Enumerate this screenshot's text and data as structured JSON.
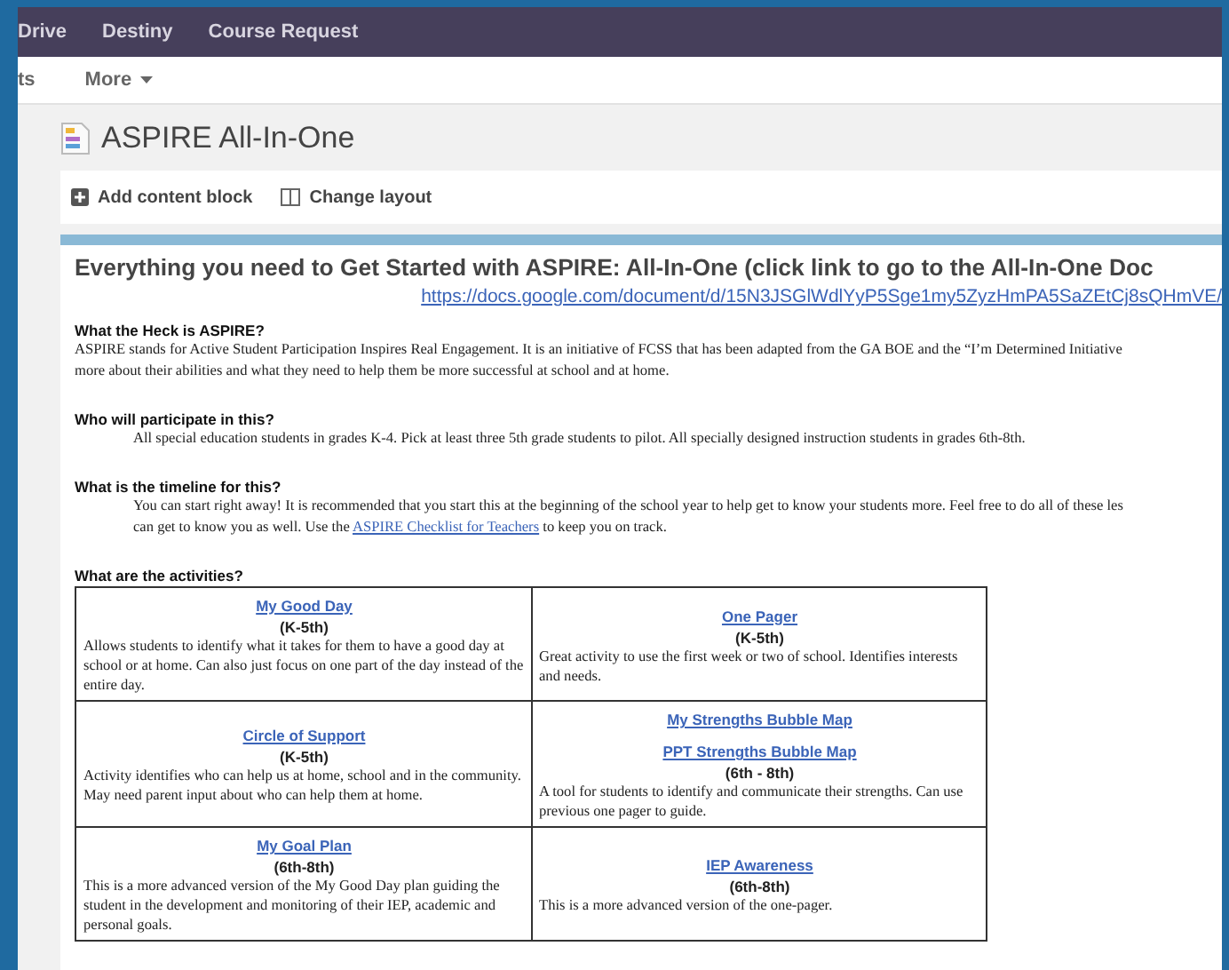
{
  "top_nav": [
    "Drive",
    "Destiny",
    "Course Request"
  ],
  "sub_nav": [
    {
      "label": "ts",
      "dropdown": false
    },
    {
      "label": "More",
      "dropdown": true
    }
  ],
  "page_title": "ASPIRE All-In-One",
  "toolbar": [
    {
      "kind": "add",
      "label": "Add content block"
    },
    {
      "kind": "layout",
      "label": "Change layout"
    }
  ],
  "content": {
    "heading": "Everything you need to Get Started with ASPIRE: All-In-One (click link to go to the All-In-One Doc",
    "doc_link": "https://docs.google.com/document/d/15N3JSGlWdlYyP5Sge1my5ZyzHmPA5SaZEtCj8sQHmVE/",
    "sections": [
      {
        "heading": "What the Heck is ASPIRE?",
        "indented": false,
        "lines": [
          {
            "kind": "text",
            "text": "ASPIRE stands for Active Student Participation Inspires Real Engagement. It is an initiative of FCSS that has been adapted from the GA BOE and the “I’m Determined Initiative"
          },
          {
            "kind": "text",
            "text": "more about their abilities and what they need to help them be more successful at school and at home."
          }
        ]
      },
      {
        "heading": "Who will participate in this?",
        "indented": true,
        "lines": [
          {
            "kind": "text",
            "text": "All special education students in grades K-4. Pick at least three 5th grade students to pilot. All specially designed instruction students in grades 6th-8th."
          }
        ]
      },
      {
        "heading": "What is the timeline for this?",
        "indented": true,
        "lines": [
          {
            "kind": "text",
            "text": "You can start right away!  It is recommended that you start this at the beginning of the school year to help get to know your students more. Feel free to do all of these les"
          },
          {
            "kind": "linked",
            "before": "can get to know you as well. Use the ",
            "link": "ASPIRE Checklist for Teachers",
            "after": " to keep you on track."
          }
        ]
      }
    ],
    "activities_heading": "What are the activities?",
    "activities": [
      [
        {
          "links": [
            "My Good Day"
          ],
          "grade": "(K-5th)",
          "description": "Allows students to identify what it takes for them to have a good day at school or at home. Can also just focus on one part of the day instead of the entire day."
        },
        {
          "links": [
            "One Pager"
          ],
          "grade": "(K-5th)",
          "description": "Great activity to use the first week or two of school. Identifies interests and needs."
        }
      ],
      [
        {
          "links": [
            "Circle of Support"
          ],
          "grade": "(K-5th)",
          "description": "Activity identifies who can help us at home, school and in the community. May need parent input about who can help them at home."
        },
        {
          "links": [
            "My Strengths Bubble Map",
            "PPT Strengths Bubble Map"
          ],
          "grade": "(6th - 8th)",
          "description": "A tool for students to identify and communicate their strengths. Can use previous one pager to guide."
        }
      ],
      [
        {
          "links": [
            "My Goal Plan"
          ],
          "grade": "(6th-8th)",
          "description": "This is a more advanced version of the My Good Day plan guiding the student in the development and monitoring of their IEP, academic and personal goals."
        },
        {
          "links": [
            "IEP Awareness"
          ],
          "grade": "(6th-8th)",
          "description": "This is a more advanced version of the one-pager."
        }
      ]
    ]
  }
}
